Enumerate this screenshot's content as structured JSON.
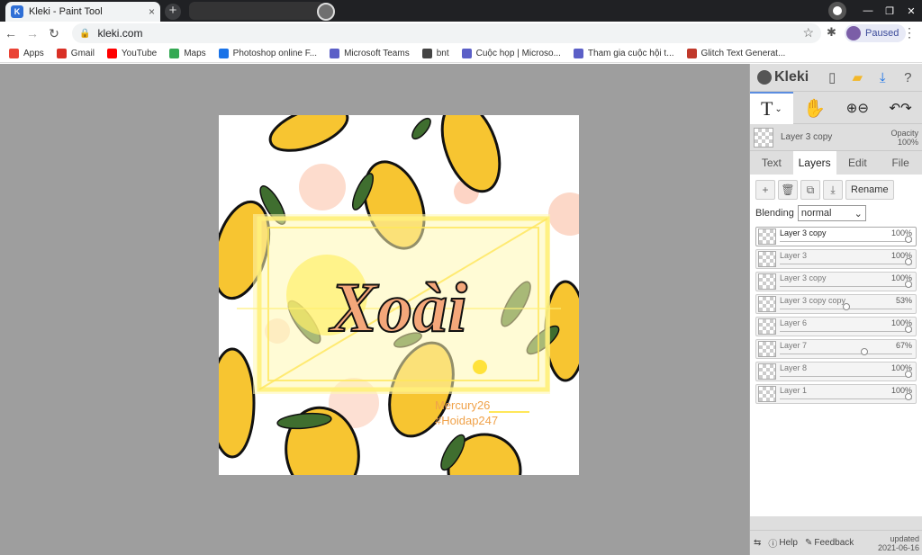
{
  "browser": {
    "tab_title": "Kleki - Paint Tool",
    "tab_close": "×",
    "new_tab": "+",
    "url": "kleki.com",
    "profile_status": "Paused",
    "bookmarks": [
      {
        "label": "Apps",
        "color": "#ea4335"
      },
      {
        "label": "Gmail",
        "color": "#d93025"
      },
      {
        "label": "YouTube",
        "color": "#ff0000"
      },
      {
        "label": "Maps",
        "color": "#34a853"
      },
      {
        "label": "Photoshop online F...",
        "color": "#1a73e8"
      },
      {
        "label": "Microsoft Teams",
        "color": "#5b5fc7"
      },
      {
        "label": "bnt",
        "color": "#444444"
      },
      {
        "label": "Cuộc họp | Microso...",
        "color": "#5b5fc7"
      },
      {
        "label": "Tham gia cuộc hội t...",
        "color": "#5b5fc7"
      },
      {
        "label": "Glitch Text Generat...",
        "color": "#c0392b"
      }
    ]
  },
  "canvas": {
    "title_text": "Xoài",
    "signature_line1": "Mercury26",
    "signature_line2": "#Hoidap247"
  },
  "sidebar": {
    "logo": "Kleki",
    "current_layer": {
      "name": "Layer 3 copy",
      "opacity_label": "Opacity",
      "opacity_value": "100%"
    },
    "tabs": [
      {
        "label": "Text",
        "active": false
      },
      {
        "label": "Layers",
        "active": true
      },
      {
        "label": "Edit",
        "active": false
      },
      {
        "label": "File",
        "active": false
      }
    ],
    "rename_label": "Rename",
    "blending_label": "Blending",
    "blending_value": "normal",
    "layers": [
      {
        "name": "Layer 3 copy",
        "opacity": "100%",
        "opacity_value": 100,
        "selected": true
      },
      {
        "name": "Layer 3",
        "opacity": "100%",
        "opacity_value": 100,
        "selected": false
      },
      {
        "name": "Layer 3 copy",
        "opacity": "100%",
        "opacity_value": 100,
        "selected": false
      },
      {
        "name": "Layer 3 copy copy",
        "opacity": "53%",
        "opacity_value": 53,
        "selected": false
      },
      {
        "name": "Layer 6",
        "opacity": "100%",
        "opacity_value": 100,
        "selected": false
      },
      {
        "name": "Layer 7",
        "opacity": "67%",
        "opacity_value": 67,
        "selected": false
      },
      {
        "name": "Layer 8",
        "opacity": "100%",
        "opacity_value": 100,
        "selected": false
      },
      {
        "name": "Layer 1",
        "opacity": "100%",
        "opacity_value": 100,
        "selected": false
      }
    ],
    "footer": {
      "help_label": "Help",
      "feedback_label": "Feedback",
      "updated_line1": "updated",
      "updated_line2": "2021-06-16"
    }
  }
}
